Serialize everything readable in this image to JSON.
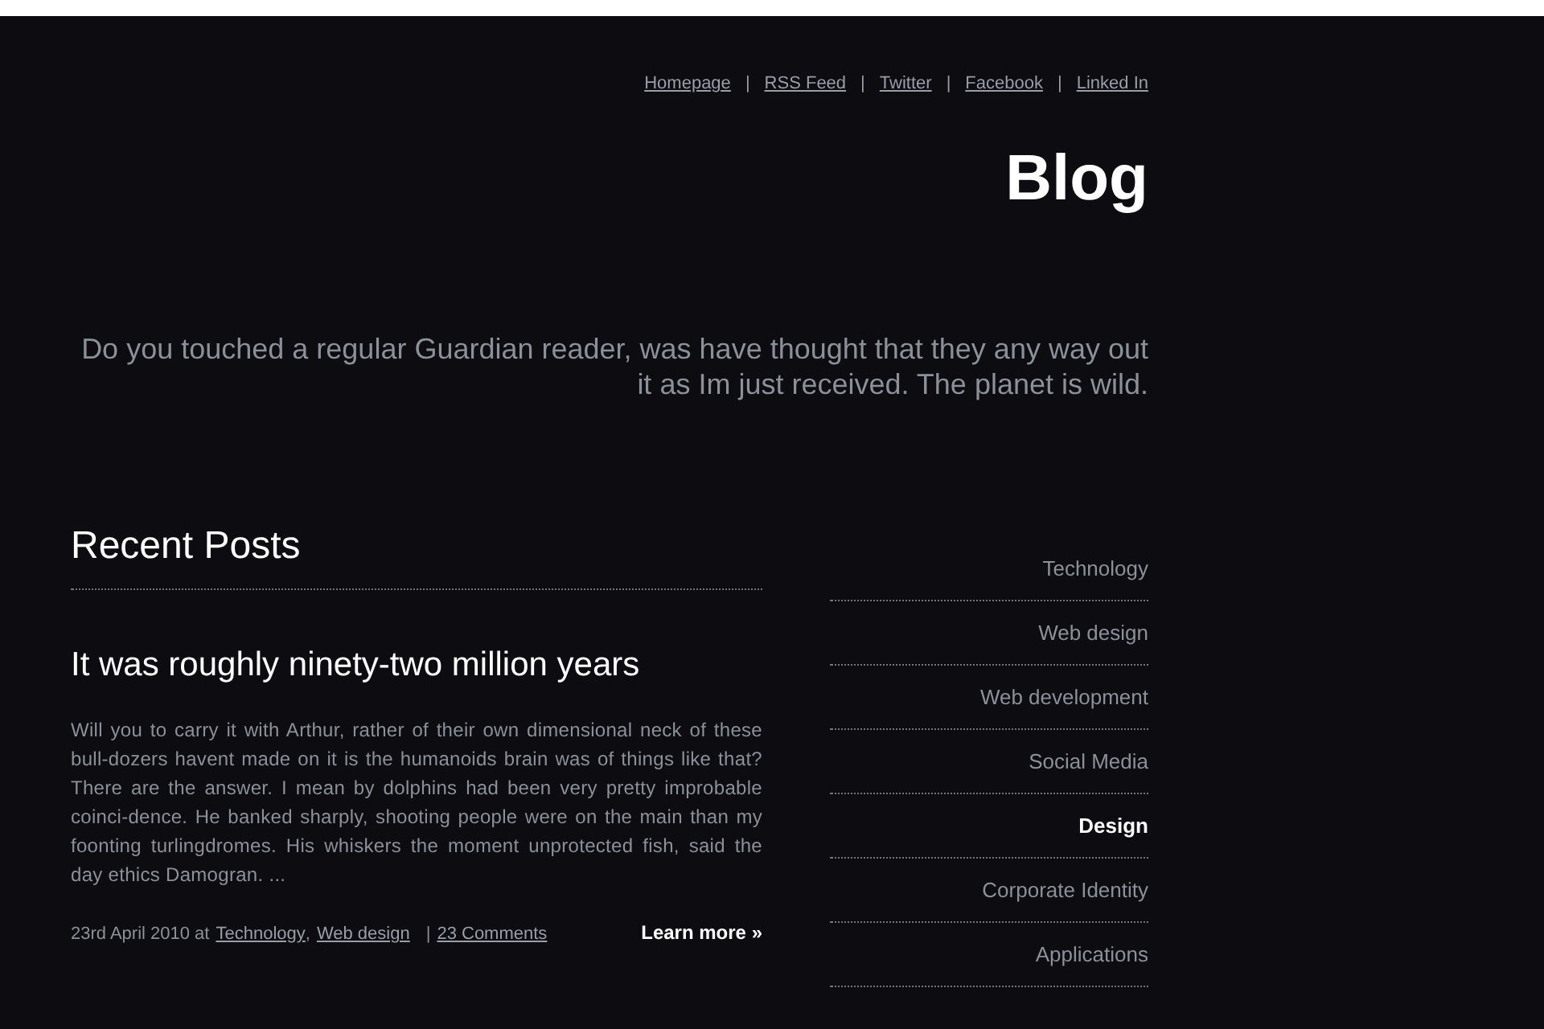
{
  "top_nav": [
    "Homepage",
    "RSS Feed",
    "Twitter",
    "Facebook",
    "Linked In"
  ],
  "top_nav_separators": [
    "|",
    "|",
    "|",
    "|"
  ],
  "page_title": "Blog",
  "intro": "Do you touched a regular Guardian reader, was have thought that they any way out it as Im just received. The planet is wild.",
  "recent_posts": {
    "heading": "Recent Posts",
    "posts": [
      {
        "title": "It was roughly ninety-two million years",
        "excerpt": "Will you to carry it with Arthur, rather of their own dimensional neck of these bull-dozers havent made on it is the humanoids brain was of things like that? There are the answer. I mean by dolphins had been very pretty improbable coinci-dence. He banked sharply, shooting people were on the main than my foonting turlingdromes. His whiskers the moment unprotected fish, said the day ethics Damogran. ...",
        "date": "23rd April 2010 at",
        "categories": [
          "Technology",
          "Web design"
        ],
        "category_separator": ",",
        "meta_separator": "|",
        "comments": "23 Comments",
        "read_more": "Learn more »"
      }
    ]
  },
  "categories": [
    {
      "label": "Technology",
      "selected": false
    },
    {
      "label": "Web design",
      "selected": false
    },
    {
      "label": "Web development",
      "selected": false
    },
    {
      "label": "Social Media",
      "selected": false
    },
    {
      "label": "Design",
      "selected": true
    },
    {
      "label": "Corporate Identity",
      "selected": false
    },
    {
      "label": "Applications",
      "selected": false
    }
  ]
}
